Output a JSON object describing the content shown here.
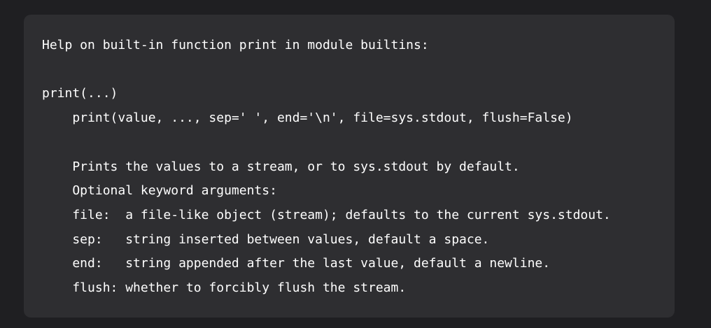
{
  "code_block": {
    "lines": [
      "Help on built-in function print in module builtins:",
      "",
      "print(...)",
      "    print(value, ..., sep=' ', end='\\n', file=sys.stdout, flush=False)",
      "",
      "    Prints the values to a stream, or to sys.stdout by default.",
      "    Optional keyword arguments:",
      "    file:  a file-like object (stream); defaults to the current sys.stdout.",
      "    sep:   string inserted between values, default a space.",
      "    end:   string appended after the last value, default a newline.",
      "    flush: whether to forcibly flush the stream."
    ]
  },
  "colors": {
    "page_background": "#1f1f22",
    "panel_background": "#2e2e31",
    "text": "#ffffff"
  }
}
